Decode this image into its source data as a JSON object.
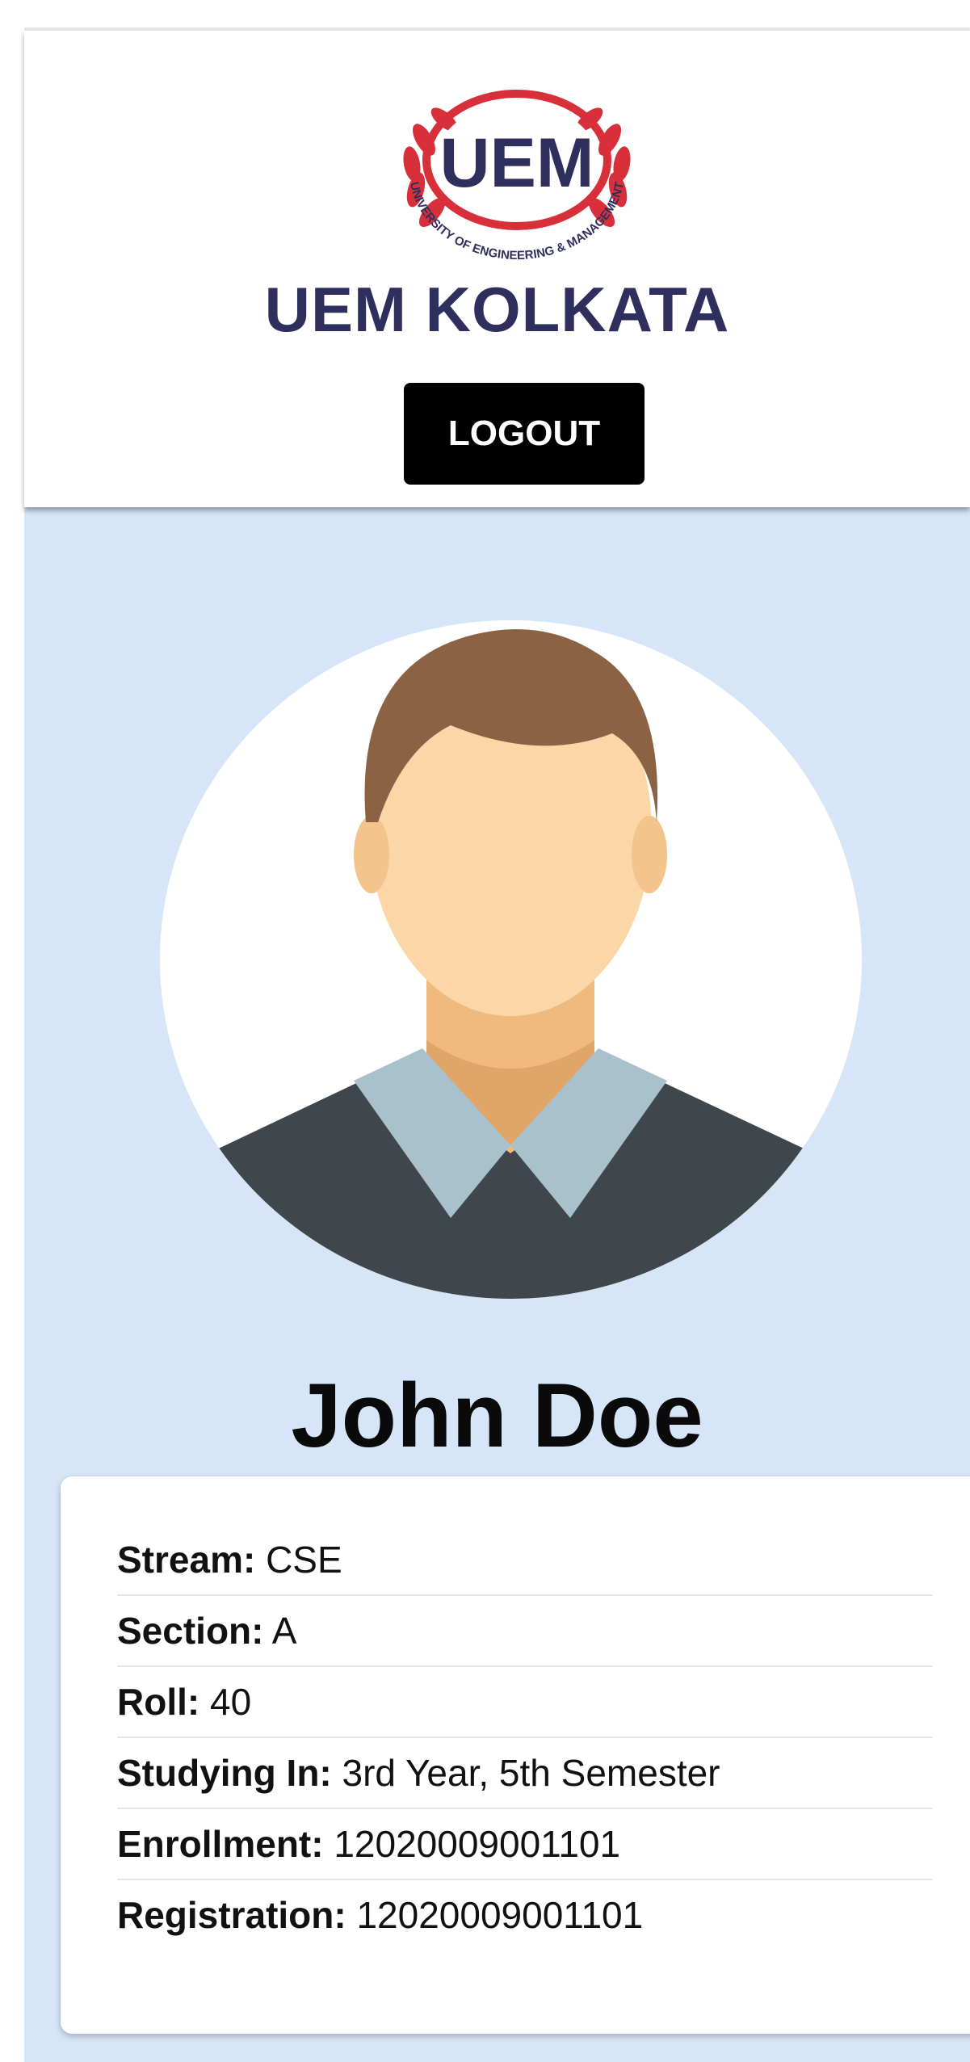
{
  "header": {
    "logo_text": "UEM",
    "logo_ring_text": "UNIVERSITY OF ENGINEERING & MANAGEMENT",
    "title": "UEM KOLKATA",
    "logout_label": "LOGOUT"
  },
  "profile": {
    "name": "John Doe",
    "fields": [
      {
        "label": "Stream:",
        "value": "CSE"
      },
      {
        "label": "Section:",
        "value": "A"
      },
      {
        "label": "Roll:",
        "value": "40"
      },
      {
        "label": "Studying In:",
        "value": "3rd Year, 5th Semester"
      },
      {
        "label": "Enrollment:",
        "value": "12020009001101"
      },
      {
        "label": "Registration:",
        "value": "12020009001101"
      }
    ]
  },
  "colors": {
    "title": "#2f2f5e",
    "main_background": "#d6e5f8",
    "logo_red": "#d8303a",
    "button": "#000000"
  }
}
